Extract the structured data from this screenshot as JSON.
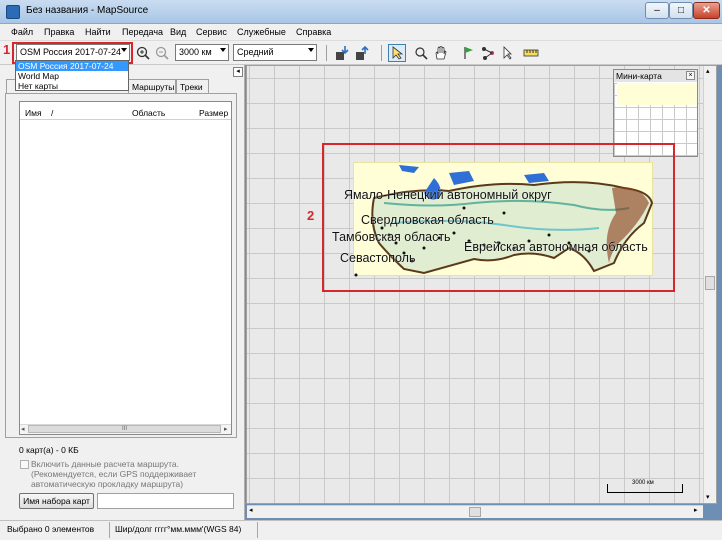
{
  "window": {
    "title": "Без названия - MapSource"
  },
  "window_controls": {
    "minimize": "‒",
    "maximize": "□",
    "close": "✕"
  },
  "menu": [
    "Файл",
    "Правка",
    "Найти",
    "Передача",
    "Вид",
    "Сервис",
    "Служебные",
    "Справка"
  ],
  "toolbar": {
    "map_select": "OSM Россия 2017-07-24",
    "scale_select": "3000 км",
    "detail_select": "Средний"
  },
  "dropdown": {
    "items": [
      "OSM Россия 2017-07-24",
      "World Map",
      "Нет карты"
    ],
    "selected_index": 0
  },
  "callouts": {
    "first": "1",
    "second": "2"
  },
  "left_panel": {
    "tabs": [
      "Маршруты",
      "Треки"
    ],
    "columns": {
      "name": "Имя",
      "sort_marker": "/",
      "area": "Область",
      "size": "Размер"
    },
    "maps_count": "0 карт(а) - 0 КБ",
    "route_option": "Включить данные расчета маршрута. (Рекомендуется, если GPS поддерживает автоматическую прокладку маршрута)",
    "mapset_button": "Имя набора карт",
    "scroll_glyph": "III"
  },
  "minimap": {
    "title": "Мини-карта"
  },
  "map_labels": [
    "Ямало-Ненецкий автономный округ",
    "Свердловская область",
    "Тамбовская область",
    "Еврейская автономная область",
    "Севастополь"
  ],
  "scale": {
    "label": "3000 км"
  },
  "status": {
    "selected": "Выбрано 0 элементов",
    "coords": "Шир/долг гггг°мм.ммм'(WGS 84)"
  },
  "colors": {
    "callout": "#d9262c",
    "selection": "#3399ff",
    "map_land": "#fffed6"
  }
}
